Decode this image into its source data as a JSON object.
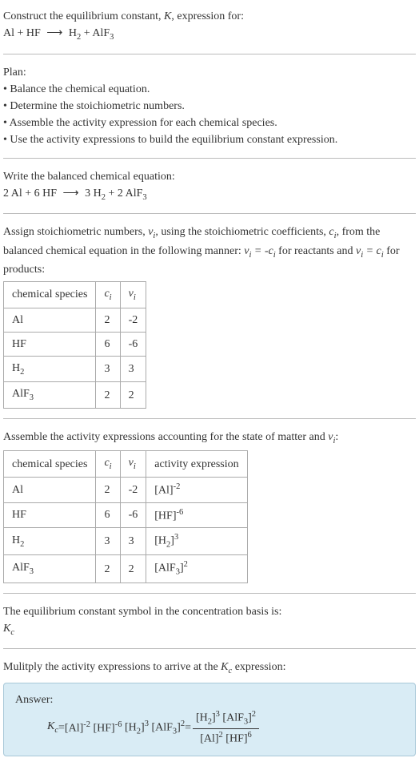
{
  "prompt": {
    "line1": "Construct the equilibrium constant, ",
    "K": "K",
    "line1b": ", expression for:",
    "eq": "Al + HF ⟶ H₂ + AlF₃"
  },
  "plan": {
    "heading": "Plan:",
    "items": [
      "Balance the chemical equation.",
      "Determine the stoichiometric numbers.",
      "Assemble the activity expression for each chemical species.",
      "Use the activity expressions to build the equilibrium constant expression."
    ]
  },
  "balanced": {
    "heading": "Write the balanced chemical equation:",
    "eq": "2 Al + 6 HF ⟶ 3 H₂ + 2 AlF₃"
  },
  "assign": {
    "text1": "Assign stoichiometric numbers, ",
    "nu": "νᵢ",
    "text2": ", using the stoichiometric coefficients, ",
    "ci": "cᵢ",
    "text3": ", from the balanced chemical equation in the following manner: ",
    "rel1": "νᵢ = -cᵢ",
    "text4": " for reactants and ",
    "rel2": "νᵢ = cᵢ",
    "text5": " for products:"
  },
  "table1": {
    "headers": [
      "chemical species",
      "cᵢ",
      "νᵢ"
    ],
    "rows": [
      {
        "species": "Al",
        "ci": "2",
        "nu": "-2"
      },
      {
        "species": "HF",
        "ci": "6",
        "nu": "-6"
      },
      {
        "species": "H₂",
        "ci": "3",
        "nu": "3"
      },
      {
        "species": "AlF₃",
        "ci": "2",
        "nu": "2"
      }
    ]
  },
  "assemble": {
    "text1": "Assemble the activity expressions accounting for the state of matter and ",
    "nu": "νᵢ",
    "text2": ":"
  },
  "table2": {
    "headers": [
      "chemical species",
      "cᵢ",
      "νᵢ",
      "activity expression"
    ],
    "rows": [
      {
        "species": "Al",
        "ci": "2",
        "nu": "-2",
        "act_base": "[Al]",
        "act_exp": "-2"
      },
      {
        "species": "HF",
        "ci": "6",
        "nu": "-6",
        "act_base": "[HF]",
        "act_exp": "-6"
      },
      {
        "species": "H₂",
        "ci": "3",
        "nu": "3",
        "act_base": "[H₂]",
        "act_exp": "3"
      },
      {
        "species": "AlF₃",
        "ci": "2",
        "nu": "2",
        "act_base": "[AlF₃]",
        "act_exp": "2"
      }
    ]
  },
  "eqconst": {
    "text": "The equilibrium constant symbol in the concentration basis is:",
    "symbol": "K_c"
  },
  "multiply": {
    "text1": "Mulitply the activity expressions to arrive at the ",
    "kc": "K_c",
    "text2": " expression:"
  },
  "answer": {
    "label": "Answer:",
    "kc": "K_c",
    "eq": " = ",
    "t1_base": "[Al]",
    "t1_exp": "-2",
    "t2_base": "[HF]",
    "t2_exp": "-6",
    "t3_base": "[H₂]",
    "t3_exp": "3",
    "t4_base": "[AlF₃]",
    "t4_exp": "2",
    "eq2": " = ",
    "num_t1_base": "[H₂]",
    "num_t1_exp": "3",
    "num_t2_base": "[AlF₃]",
    "num_t2_exp": "2",
    "den_t1_base": "[Al]",
    "den_t1_exp": "2",
    "den_t2_base": "[HF]",
    "den_t2_exp": "6"
  }
}
